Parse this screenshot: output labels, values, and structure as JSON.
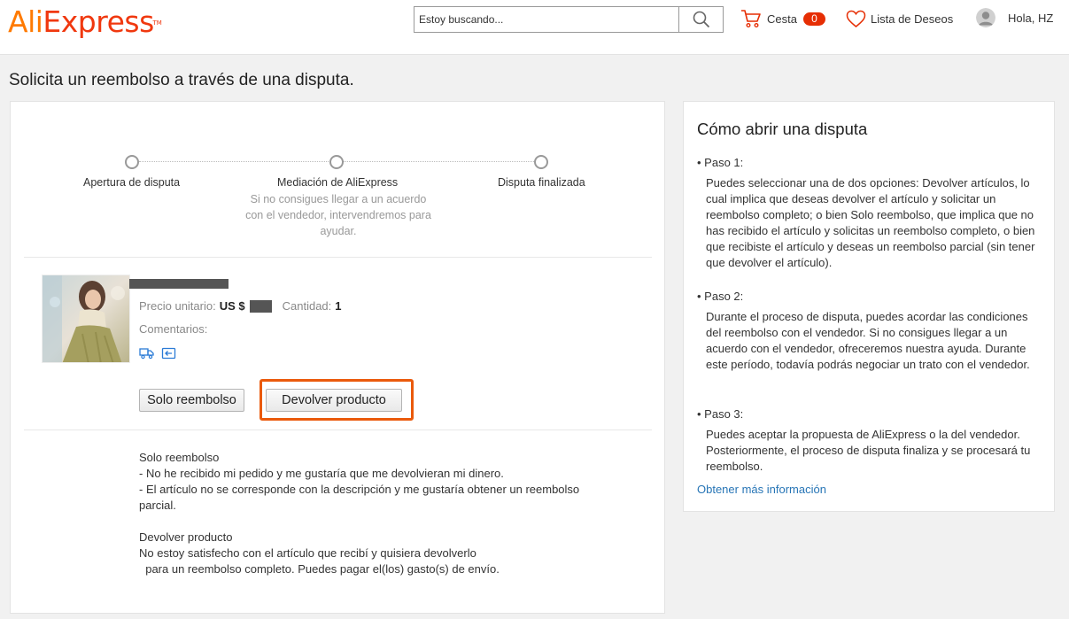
{
  "header": {
    "logo": {
      "part1": "Ali",
      "part2": "Express",
      "tm": "TM"
    },
    "search_placeholder": "Estoy buscando...",
    "cart_label": "Cesta",
    "cart_count": "0",
    "wishlist_label": "Lista de Deseos",
    "user_greeting": "Hola, HZ",
    "colors": {
      "logo_orange": "#ff7a00",
      "logo_red": "#f0380f",
      "badge": "#e62e04"
    }
  },
  "page_title": "Solicita un reembolso a través de una disputa.",
  "stepper": {
    "steps": [
      {
        "label": "Apertura de disputa"
      },
      {
        "label": "Mediación de AliExpress",
        "description": "Si no consigues llegar a un acuerdo con el vendedor, intervendremos para ayudar."
      },
      {
        "label": "Disputa finalizada"
      }
    ]
  },
  "product": {
    "unit_price_label": "Precio unitario:",
    "currency": "US $",
    "quantity_label": "Cantidad:",
    "quantity": "1",
    "comments_label": "Comentarios:",
    "icons": [
      "shipping-truck-icon",
      "return-arrow-icon"
    ]
  },
  "actions": {
    "refund_only": "Solo reembolso",
    "return_product": "Devolver producto",
    "highlight_color": "#ea5a0c"
  },
  "info": {
    "refund_title": "Solo reembolso",
    "refund_lines": [
      "- No he recibido mi pedido y me gustaría que me devolvieran mi dinero.",
      "- El artículo no se corresponde con la descripción y me gustaría obtener un reembolso",
      "parcial."
    ],
    "return_title": "Devolver producto",
    "return_lines": [
      "No estoy satisfecho con el artículo que recibí y quisiera devolverlo",
      "  para un reembolso completo. Puedes pagar el(los) gasto(s) de envío."
    ]
  },
  "howto": {
    "title": "Cómo abrir una disputa",
    "steps": [
      {
        "head": "• Paso 1:",
        "text": "Puedes seleccionar una de dos opciones: Devolver artículos, lo cual implica que deseas devolver el artículo y solicitar un reembolso completo; o bien Solo reembolso, que implica que no has recibido el artículo y solicitas un reembolso completo, o bien que recibiste el artículo y deseas un reembolso parcial (sin tener que devolver el artículo)."
      },
      {
        "head": "• Paso 2:",
        "text": "Durante el proceso de disputa, puedes acordar las condiciones del reembolso con el vendedor. Si no consigues llegar a un acuerdo con el vendedor, ofreceremos nuestra ayuda. Durante este período, todavía podrás negociar un trato con el vendedor."
      },
      {
        "head": "• Paso 3:",
        "text": "Puedes aceptar la propuesta de AliExpress o la del vendedor. Posteriormente, el proceso de disputa finaliza y se procesará tu reembolso."
      }
    ],
    "more_link": "Obtener más información",
    "link_color": "#2775b6"
  }
}
